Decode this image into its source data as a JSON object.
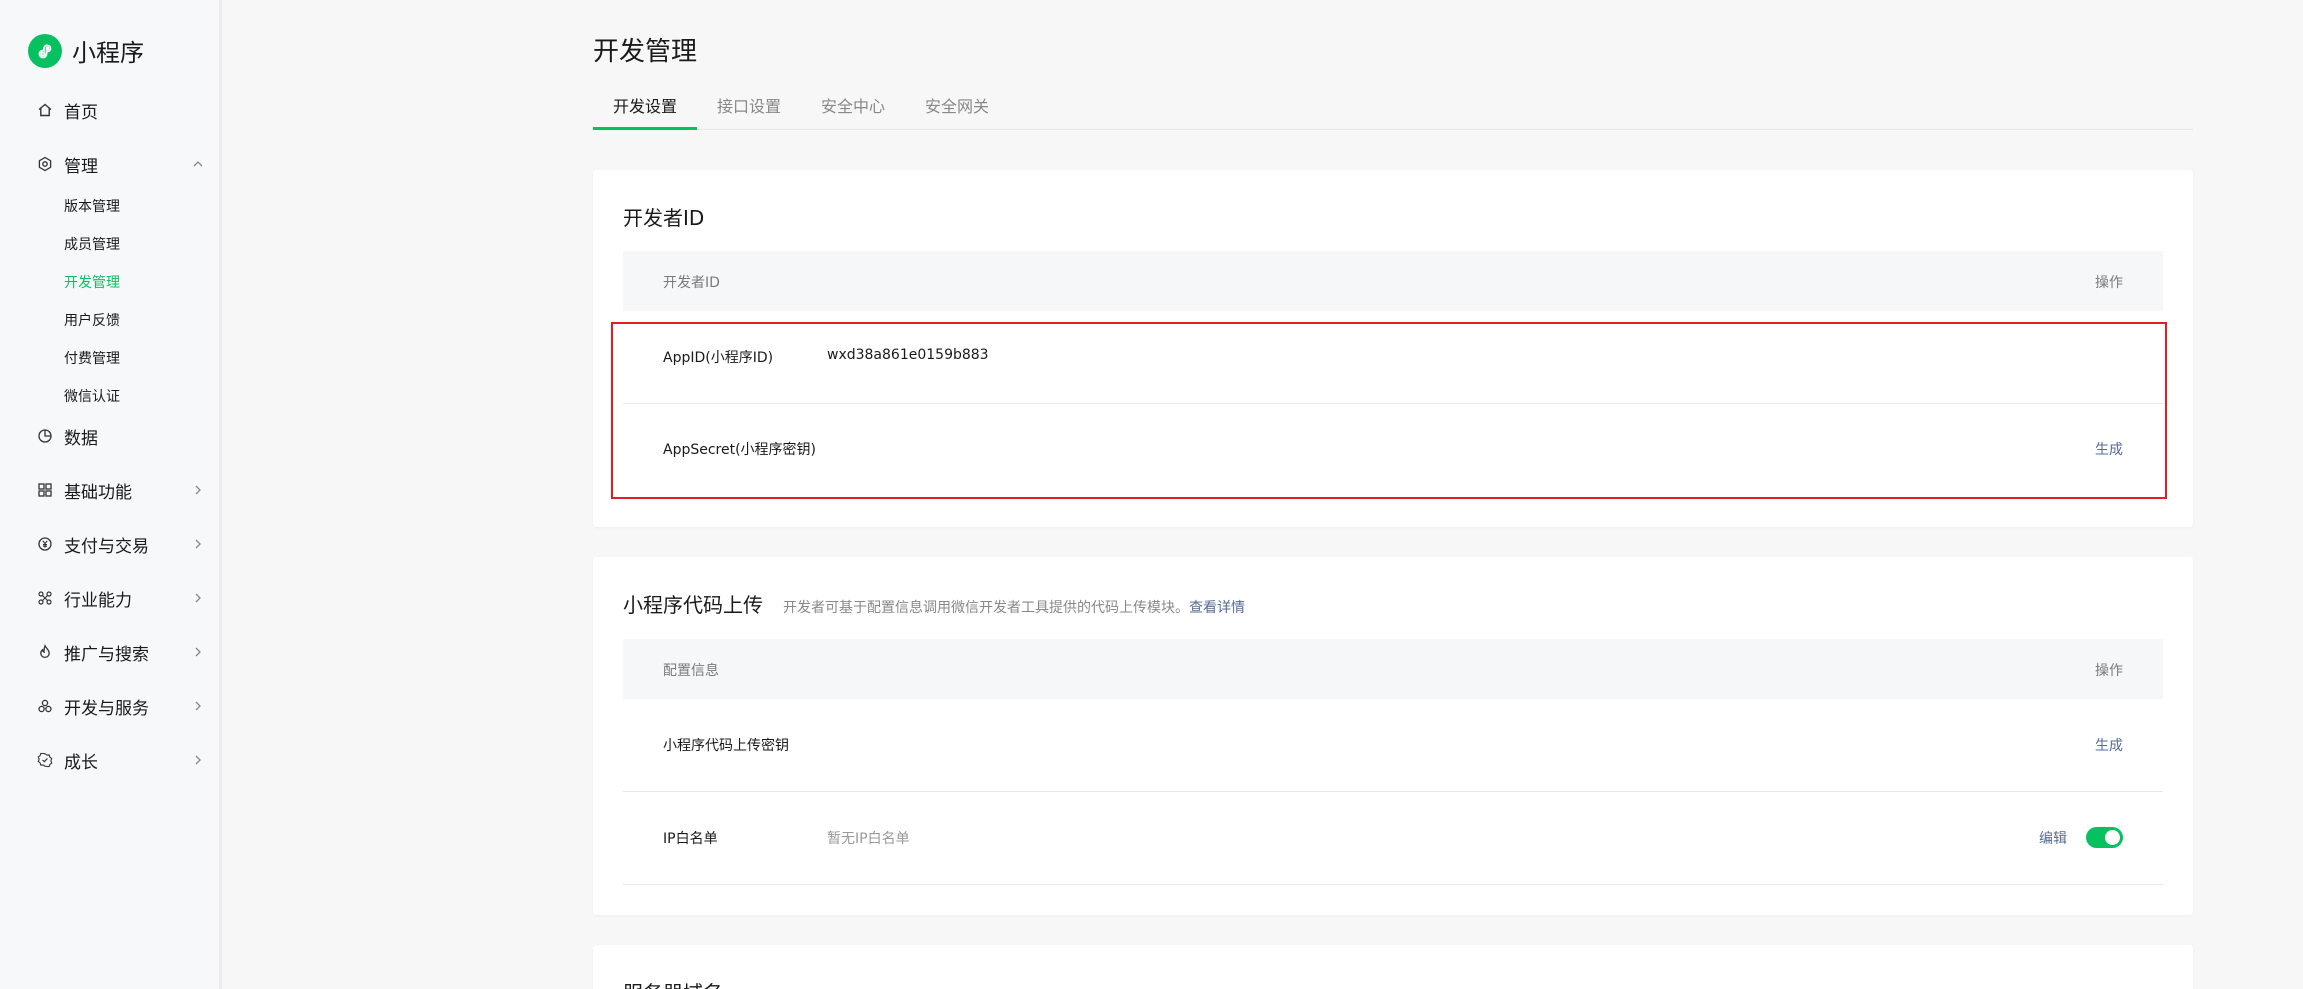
{
  "app": {
    "title": "小程序"
  },
  "colors": {
    "accent": "#07c160",
    "link": "#576b95",
    "highlight_border": "#e02020"
  },
  "sidebar": {
    "home": "首页",
    "manage": "管理",
    "manage_items": [
      "版本管理",
      "成员管理",
      "开发管理",
      "用户反馈",
      "付费管理",
      "微信认证"
    ],
    "active_item": "开发管理",
    "data": "数据",
    "basic": "基础功能",
    "pay": "支付与交易",
    "industry": "行业能力",
    "promote": "推广与搜索",
    "devservice": "开发与服务",
    "growth": "成长"
  },
  "main": {
    "title": "开发管理",
    "tabs": [
      "开发设置",
      "接口设置",
      "安全中心",
      "安全网关"
    ],
    "active_tab": "开发设置"
  },
  "dev_id_card": {
    "title": "开发者ID",
    "col_id": "开发者ID",
    "col_action": "操作",
    "appid_label": "AppID(小程序ID)",
    "appid_value": "wxd38a861e0159b883",
    "secret_label": "AppSecret(小程序密钥)",
    "secret_action": "生成"
  },
  "upload_card": {
    "title": "小程序代码上传",
    "desc": "开发者可基于配置信息调用微信开发者工具提供的代码上传模块。",
    "detail_link": "查看详情",
    "col_config": "配置信息",
    "col_action": "操作",
    "key_label": "小程序代码上传密钥",
    "key_action": "生成",
    "ip_label": "IP白名单",
    "ip_value": "暂无IP白名单",
    "ip_action": "编辑",
    "ip_toggle_on": true
  },
  "server_card": {
    "title": "服务器域名"
  }
}
